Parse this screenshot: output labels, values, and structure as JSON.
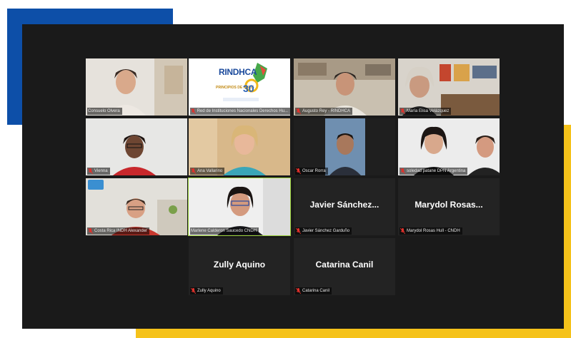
{
  "participants": [
    {
      "name": "Consuelo Olvera",
      "muted": false
    },
    {
      "name": "Red de Instituciones Nacionales Derechos Hu...",
      "muted": true,
      "logo": {
        "title": "RINDHCA",
        "subtitle": "PRINCIPIOS DE PARIS",
        "number": "30"
      }
    },
    {
      "name": "Augusto Rey - RINDHCA",
      "muted": true
    },
    {
      "name": "María Elisa Velázquez",
      "muted": true
    },
    {
      "name": "Vienna",
      "muted": true
    },
    {
      "name": "Ana Vallarino",
      "muted": true
    },
    {
      "name": "Oscar Rorra",
      "muted": true
    },
    {
      "name": "soledad patane DPN Argentina",
      "muted": true
    },
    {
      "name": "Costa Rica INDH Alexander",
      "muted": true
    },
    {
      "name": "Marlene Calderon Saucedo CNDH",
      "muted": false,
      "speaking": true
    },
    {
      "name": "Javier Sánchez Garduño",
      "muted": true,
      "display": "Javier  Sánchez..."
    },
    {
      "name": "Marydol Rosas Hull - CNDH",
      "muted": true,
      "display": "Marydol  Rosas..."
    },
    {
      "name": "Zully Aquino",
      "muted": true,
      "display": "Zully Aquino"
    },
    {
      "name": "Catarina Canil",
      "muted": true,
      "display": "Catarina Canil"
    }
  ],
  "colors": {
    "accent_blue": "#0d4fa8",
    "accent_yellow": "#f5c21a",
    "speaking": "#9bd13a",
    "muted_icon": "#e0322c"
  },
  "icons": {
    "muted": "mic-muted-icon"
  }
}
